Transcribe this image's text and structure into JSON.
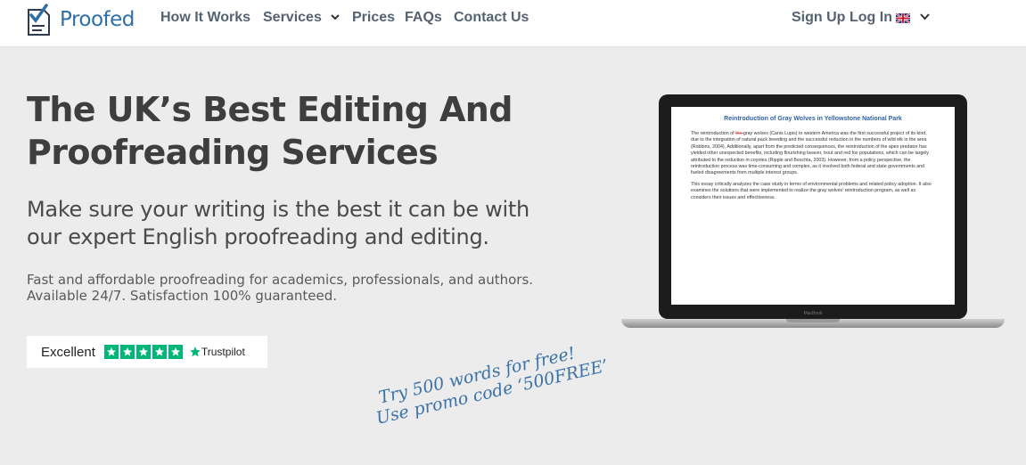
{
  "header": {
    "logo_text": "Proofed",
    "nav": [
      "How It Works",
      "Services",
      "Prices",
      "FAQs",
      "Contact Us"
    ],
    "sign_up": "Sign Up",
    "log_in": "Log In"
  },
  "hero": {
    "headline_line1": "The UK’s Best Editing And",
    "headline_line2": "Proofreading Services",
    "subheadline_line1": "Make sure your writing is the best it can be with",
    "subheadline_line2": "our expert English proofreading and editing.",
    "desc_line1": "Fast and affordable proofreading for academics, professionals, and authors.",
    "desc_line2": "Available 24/7. Satisfaction 100% guaranteed."
  },
  "trustpilot": {
    "label": "Excellent",
    "brand": "Trustpilot",
    "stars": 5
  },
  "promo": {
    "line1": "Try 500 words for free!",
    "line2": "Use promo code ‘500FREE’"
  },
  "laptop": {
    "doc_title": "Reintroduction of Gray Wolves in Yellowstone National Park",
    "brand_label": "MacBook",
    "paragraph1_prefix": "The reintroduction of ",
    "paragraph1_body": "gray wolves (Canis Lupis) to western America was the first successful project of its kind, due to the integration of natural pack breeding and the successful reduction in the numbers of wild elk in the area (Robbins, 2004). Additionally, apart from the predicted consequences, the reintroduction of the apex predator has yielded other unexpected benefits, including flourishing beaver, trout and red fox populations, which can be largely attributed to the reduction in coyotes (Ripple and Beschta, 2003). However, from a policy perspective, the reintroduction process was time-consuming and complex, as it involved both federal and state governments and fueled disagreements from multiple interest groups.",
    "paragraph2": "This essay critically analyzes the case study in terms of environmental problems and related policy adoption. It also examines the solutions that were implemented to realize the gray wolves’ reintroduction program, as well as considers their issues and effectiveness."
  },
  "colors": {
    "brand_blue": "#2f6fa8",
    "nav_text": "#556270",
    "trustpilot_green": "#00b67a",
    "background": "#ececec"
  }
}
